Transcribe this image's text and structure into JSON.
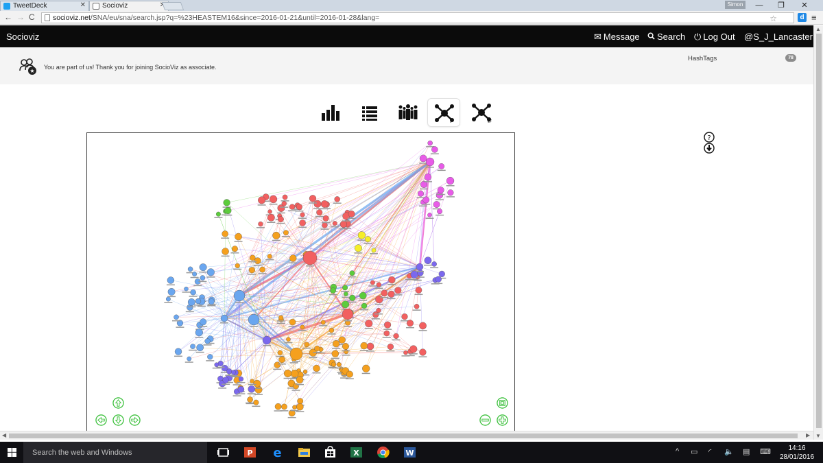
{
  "browser": {
    "tabs": [
      {
        "label": "TweetDeck",
        "favicon_color": "#1da1f2",
        "active": false
      },
      {
        "label": "Socioviz",
        "favicon_color": "#6c6c6c",
        "active": true
      }
    ],
    "window_user": "Simon",
    "url_host": "socioviz.net",
    "url_path": "/SNA/eu/sna/search.jsp?q=%23HEASTEM16&since=2016-01-21&until=2016-01-28&lang=",
    "extension_label": "d"
  },
  "nav": {
    "brand": "Socioviz",
    "items": [
      {
        "id": "message",
        "label": "Message",
        "icon": "envelope-icon"
      },
      {
        "id": "search",
        "label": "Search",
        "icon": "search-icon"
      },
      {
        "id": "logout",
        "label": "Log Out",
        "icon": "power-icon"
      },
      {
        "id": "account",
        "label": "@S_J_Lancaster",
        "icon": "caret-down-icon"
      }
    ]
  },
  "info": {
    "message": "You are part of us! Thank you for joining SocioViz as associate.",
    "hashtags_label": "HashTags",
    "hashtags_count": "78"
  },
  "view_tabs": [
    {
      "id": "stats",
      "icon": "bar-chart-icon",
      "active": false
    },
    {
      "id": "list",
      "icon": "list-icon",
      "active": false
    },
    {
      "id": "users",
      "icon": "users-icon",
      "active": false
    },
    {
      "id": "network",
      "icon": "network-icon",
      "active": true
    },
    {
      "id": "hashtag-network",
      "icon": "hashtag-network-icon",
      "active": false
    }
  ],
  "graph": {
    "palette": [
      "#f26060",
      "#f5a01e",
      "#6aa6ef",
      "#7b68ee",
      "#5ccc3c",
      "#e85be8",
      "#f5ee2a"
    ],
    "controls": [
      "pan-up",
      "pan-left",
      "pan-down",
      "pan-right",
      "fit-to-screen",
      "zoom-out",
      "zoom-in"
    ]
  },
  "taskbar": {
    "search_placeholder": "Search the web and Windows",
    "time": "14:16",
    "date": "28/01/2016"
  }
}
